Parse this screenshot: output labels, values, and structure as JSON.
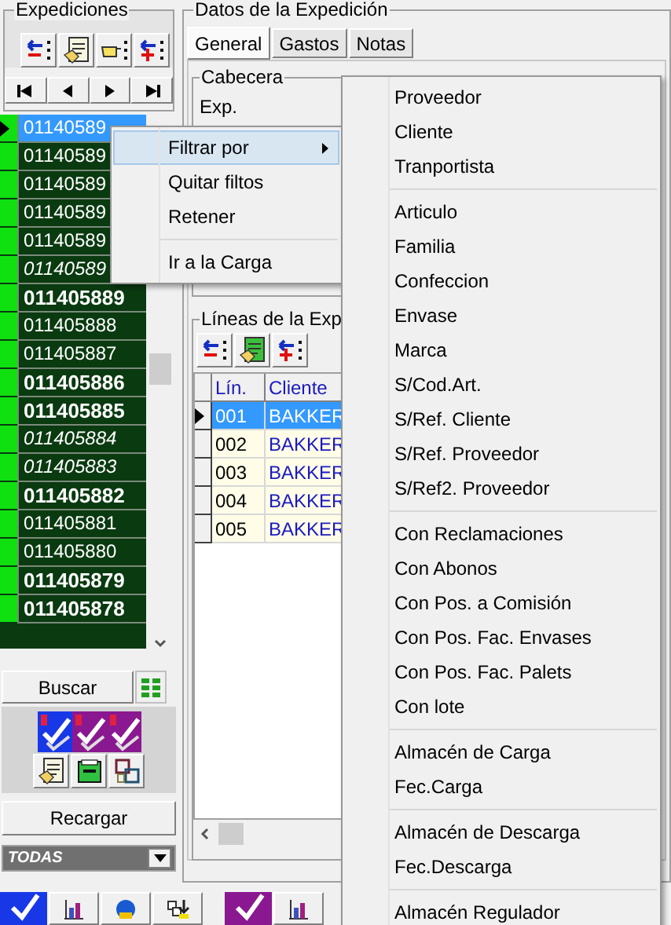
{
  "sidebar": {
    "title": "Expediciones",
    "rows": [
      {
        "number": "01140589",
        "kind": "normal",
        "selected": true
      },
      {
        "number": "01140589",
        "kind": "normal",
        "selected": false
      },
      {
        "number": "01140589",
        "kind": "normal",
        "selected": false
      },
      {
        "number": "01140589",
        "kind": "normal",
        "selected": false
      },
      {
        "number": "01140589",
        "kind": "normal",
        "selected": false
      },
      {
        "number": "01140589",
        "kind": "italic",
        "selected": false
      },
      {
        "number": "011405889",
        "kind": "bold",
        "selected": false
      },
      {
        "number": "011405888",
        "kind": "normal",
        "selected": false
      },
      {
        "number": "011405887",
        "kind": "normal",
        "selected": false
      },
      {
        "number": "011405886",
        "kind": "bold",
        "selected": false
      },
      {
        "number": "011405885",
        "kind": "bold",
        "selected": false
      },
      {
        "number": "011405884",
        "kind": "italic",
        "selected": false
      },
      {
        "number": "011405883",
        "kind": "italic",
        "selected": false
      },
      {
        "number": "011405882",
        "kind": "bold",
        "selected": false
      },
      {
        "number": "011405881",
        "kind": "normal",
        "selected": false
      },
      {
        "number": "011405880",
        "kind": "normal",
        "selected": false
      },
      {
        "number": "011405879",
        "kind": "bold",
        "selected": false
      },
      {
        "number": "011405878",
        "kind": "bold",
        "selected": false
      }
    ],
    "search_button": "Buscar",
    "reload_button": "Recargar",
    "filter": {
      "value": "TODAS"
    }
  },
  "details": {
    "title": "Datos de la Expedición",
    "tabs": [
      {
        "label": "General",
        "selected": true
      },
      {
        "label": "Gastos",
        "selected": false
      },
      {
        "label": "Notas",
        "selected": false
      }
    ],
    "header_group": {
      "title": "Cabecera",
      "label": "Exp."
    },
    "lines": {
      "title": "Líneas de la Exp",
      "columns": [
        "Lín.",
        "Cliente"
      ],
      "rows": [
        {
          "line": "001",
          "client": "BAKKER",
          "selected": true
        },
        {
          "line": "002",
          "client": "BAKKER",
          "selected": false
        },
        {
          "line": "003",
          "client": "BAKKER",
          "selected": false
        },
        {
          "line": "004",
          "client": "BAKKER",
          "selected": false
        },
        {
          "line": "005",
          "client": "BAKKER",
          "selected": false
        }
      ]
    }
  },
  "context_menu": {
    "items": [
      {
        "kind": "submenu",
        "label": "Filtrar por",
        "selected": true
      },
      {
        "kind": "item",
        "label": "Quitar filtos",
        "selected": false
      },
      {
        "kind": "item",
        "label": "Retener",
        "selected": false
      },
      {
        "kind": "separator"
      },
      {
        "kind": "item",
        "label": "Ir a la Carga",
        "selected": false
      }
    ]
  },
  "submenu": {
    "items": [
      {
        "kind": "item",
        "label": "Proveedor"
      },
      {
        "kind": "item",
        "label": "Cliente"
      },
      {
        "kind": "item",
        "label": "Tranportista"
      },
      {
        "kind": "separator"
      },
      {
        "kind": "item",
        "label": "Articulo"
      },
      {
        "kind": "item",
        "label": "Familia"
      },
      {
        "kind": "item",
        "label": "Confeccion"
      },
      {
        "kind": "item",
        "label": "Envase"
      },
      {
        "kind": "item",
        "label": "Marca"
      },
      {
        "kind": "item",
        "label": "S/Cod.Art."
      },
      {
        "kind": "item",
        "label": "S/Ref. Cliente"
      },
      {
        "kind": "item",
        "label": "S/Ref. Proveedor"
      },
      {
        "kind": "item",
        "label": "S/Ref2. Proveedor"
      },
      {
        "kind": "separator"
      },
      {
        "kind": "item",
        "label": "Con Reclamaciones"
      },
      {
        "kind": "item",
        "label": "Con Abonos"
      },
      {
        "kind": "item",
        "label": "Con Pos. a Comisión"
      },
      {
        "kind": "item",
        "label": "Con Pos. Fac. Envases"
      },
      {
        "kind": "item",
        "label": "Con Pos. Fac. Palets"
      },
      {
        "kind": "item",
        "label": "Con lote"
      },
      {
        "kind": "separator"
      },
      {
        "kind": "item",
        "label": "Almacén de Carga"
      },
      {
        "kind": "item",
        "label": "Fec.Carga"
      },
      {
        "kind": "separator"
      },
      {
        "kind": "item",
        "label": "Almacén de Descarga"
      },
      {
        "kind": "item",
        "label": "Fec.Descarga"
      },
      {
        "kind": "separator"
      },
      {
        "kind": "item",
        "label": "Almacén Regulador"
      }
    ]
  }
}
